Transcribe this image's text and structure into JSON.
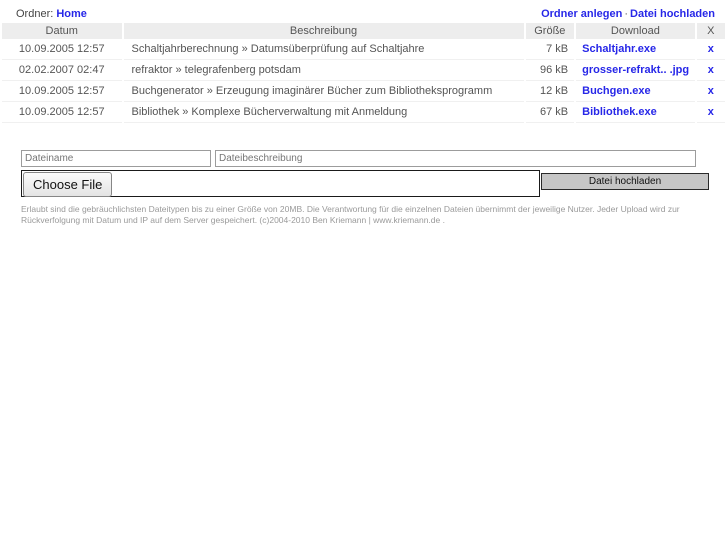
{
  "topbar": {
    "folder_label": "Ordner:",
    "folder_name": "Home",
    "create_folder_link": "Ordner anlegen",
    "separator": "·",
    "upload_link": "Datei hochladen"
  },
  "table": {
    "headers": {
      "date": "Datum",
      "description": "Beschreibung",
      "size": "Größe",
      "download": "Download",
      "delete": "X"
    },
    "rows": [
      {
        "date": "10.09.2005 12:57",
        "description": "Schaltjahrberechnung » Datumsüberprüfung auf Schaltjahre",
        "size": "7 kB",
        "download": "Schaltjahr.exe",
        "delete": "x"
      },
      {
        "date": "02.02.2007 02:47",
        "description": "refraktor » telegrafenberg potsdam",
        "size": "96 kB",
        "download": "grosser-refrakt.. .jpg",
        "delete": "x"
      },
      {
        "date": "10.09.2005 12:57",
        "description": "Buchgenerator » Erzeugung imaginärer Bücher zum Bibliotheksprogramm",
        "size": "12 kB",
        "download": "Buchgen.exe",
        "delete": "x"
      },
      {
        "date": "10.09.2005 12:57",
        "description": "Bibliothek » Komplexe Bücherverwaltung mit Anmeldung",
        "size": "67 kB",
        "download": "Bibliothek.exe",
        "delete": "x"
      }
    ]
  },
  "form": {
    "filename_value": "",
    "filename_placeholder": "Dateiname",
    "description_value": "",
    "description_placeholder": "Dateibeschreibung",
    "choose_file_label": "Choose File",
    "chosen_file_text": "",
    "upload_button_label": "Datei hochladen"
  },
  "footer": {
    "text": "Erlaubt sind die gebräuchlichsten Dateitypen bis zu einer Größe von 20MB. Die Verantwortung für die einzelnen Dateien übernimmt der jeweilige Nutzer. Jeder Upload wird zur Rückverfolgung mit Datum und IP auf dem Server gespeichert. (c)2004-2010 Ben Kriemann | www.kriemann.de ."
  },
  "colors": {
    "link": "#2727e8",
    "header_bg": "#ededed",
    "text": "#555555",
    "footer_text": "#9a9a9a"
  }
}
